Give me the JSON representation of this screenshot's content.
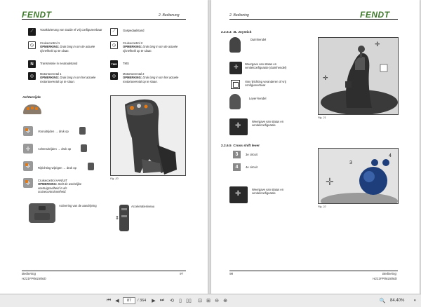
{
  "left": {
    "logo": "FENDT",
    "section": "2. Bedienung",
    "items": [
      {
        "text": "Voraktivierung von Guide ef vrij configureerbaar"
      },
      {
        "text": "Gaspedaalstand"
      },
      {
        "text": "Cruisecontrol 1",
        "note_label": "OPMERKING:",
        "note": "Druk lang in om de actuele rijsnelheid op te slaan."
      },
      {
        "text": "Cruisecontrol 2",
        "note_label": "OPMERKING:",
        "note": "Druk lang in om de actuele rijsnelheid op te slaan."
      },
      {
        "text": "Transmissie in neutraalstand",
        "glyph": "N"
      },
      {
        "text": "TMS",
        "glyph": "TMS"
      },
      {
        "text": "Motortoerental 1",
        "note_label": "OPMERKING:",
        "note": "Druk lang in om het actuele motortoerental op te slaan."
      },
      {
        "text": "Motortoerental 2",
        "note_label": "OPMERKING:",
        "note": "Druk lang in om het actuele motortoerental op te slaan."
      }
    ],
    "achterzijde": "Achterzijde",
    "rear_items": [
      {
        "text": "Vooruitrijden → druk op"
      },
      {
        "text": "Achteruitrijden → druk op"
      },
      {
        "text": "Rijrichting wijzigen → druk op"
      },
      {
        "text": "Cruisecontrol AAN/UIT",
        "note_label": "OPMERKING:",
        "note": "Stelt de werkelijke voertuigsnelheid in als cruisecontrolsnelheid."
      }
    ],
    "bottom_left": "Activering van de aandrijving",
    "bottom_right": "Acceleratieniveau",
    "fig_caption": "Fig. 20",
    "footer_title": "Bediening",
    "footer_code": "H221FP061806D",
    "page_number": "97"
  },
  "right": {
    "logo": "FENDT",
    "section": "2. Bediening",
    "heading1_num": "2.2.6.4",
    "heading1": "3L Joystick",
    "items": [
      {
        "text": "Duimhendel"
      },
      {
        "text": "Weergave van status en ventielconfiguratie (duimhendel)"
      },
      {
        "text": "Van rijrichting veranderen of vrij configureerbaar"
      },
      {
        "text": "Leyer-hendel"
      },
      {
        "text": "Weergave van status en ventielconfiguratie"
      }
    ],
    "heading2_num": "2.2.6.5",
    "heading2": "Cross shift lever",
    "circuits": [
      {
        "glyph": "3",
        "text": "3e circuit"
      },
      {
        "glyph": "4",
        "text": "4e circuit"
      }
    ],
    "last_item": "Weergave van status en ventielconfiguratie",
    "fig1_caption": "Fig. 21",
    "fig2_caption": "Fig. 22",
    "footer_title": "Bediening",
    "footer_code": "H221FP061806D",
    "page_number": "98"
  },
  "toolbar": {
    "current_page": "87",
    "total_pages": "/ 364",
    "zoom": "84.40%"
  }
}
